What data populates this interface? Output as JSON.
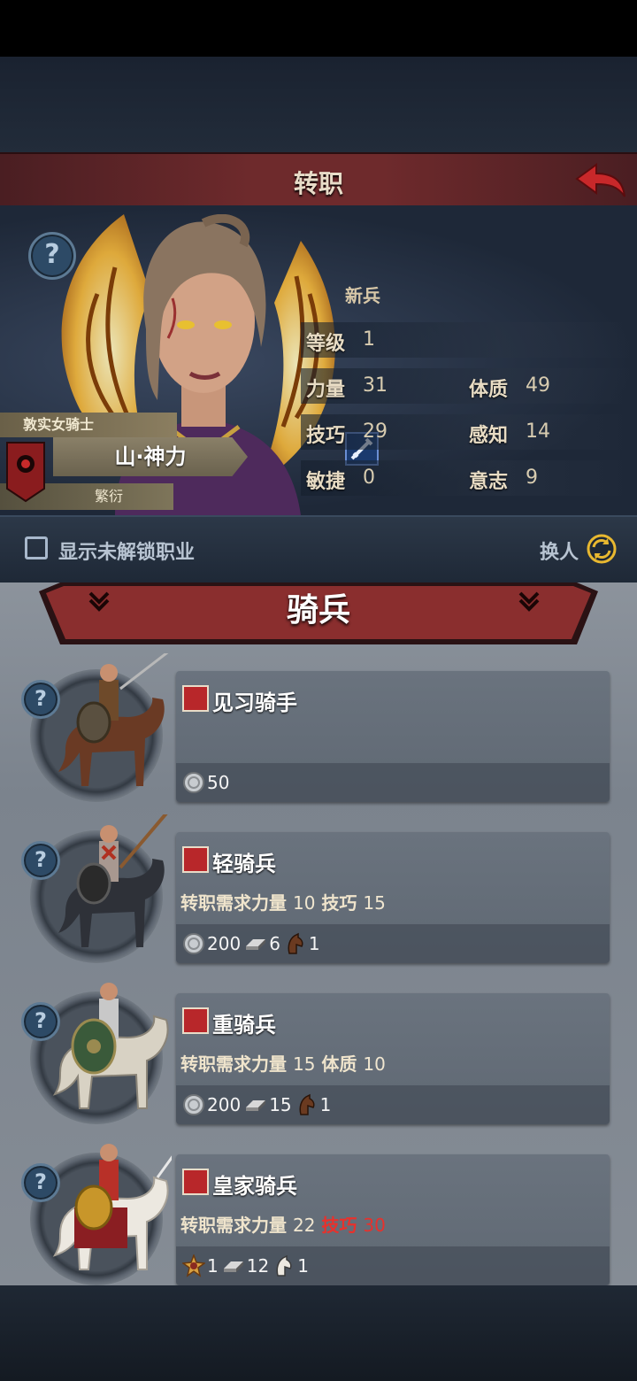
{
  "header": {
    "title": "转职"
  },
  "character": {
    "title": "敦实女骑士",
    "name": "山·神力",
    "sub": "繁衍",
    "class_name": "新兵",
    "stats": {
      "level_label": "等级",
      "level": "1",
      "str_label": "力量",
      "str": "31",
      "con_label": "体质",
      "con": "49",
      "skill_label": "技巧",
      "skill": "29",
      "per_label": "感知",
      "per": "14",
      "agi_label": "敏捷",
      "agi": "0",
      "will_label": "意志",
      "will": "9"
    }
  },
  "toolbar": {
    "show_locked_label": "显示未解锁职业",
    "swap_label": "换人"
  },
  "category": {
    "title": "骑兵"
  },
  "jobs": [
    {
      "name": "见习骑手",
      "costs": {
        "silver": "50"
      }
    },
    {
      "name": "轻骑兵",
      "req_prefix": "转职需求",
      "req1_label": "力量",
      "req1_val": "10",
      "req2_label": "技巧",
      "req2_val": "15",
      "costs": {
        "silver": "200",
        "iron": "6",
        "horse": "1"
      }
    },
    {
      "name": "重骑兵",
      "req_prefix": "转职需求",
      "req1_label": "力量",
      "req1_val": "15",
      "req2_label": "体质",
      "req2_val": "10",
      "costs": {
        "silver": "200",
        "iron": "15",
        "horse": "1"
      }
    },
    {
      "name": "皇家骑兵",
      "req_prefix": "转职需求",
      "req1_label": "力量",
      "req1_val": "22",
      "req2_label": "技巧",
      "req2_val": "30",
      "costs": {
        "medal": "1",
        "iron": "12",
        "horse": "1"
      }
    }
  ],
  "colors": {
    "accent_red": "#b8272a",
    "unmet_requirement": "#e8312c",
    "title_bar": "#6e2a2c"
  }
}
